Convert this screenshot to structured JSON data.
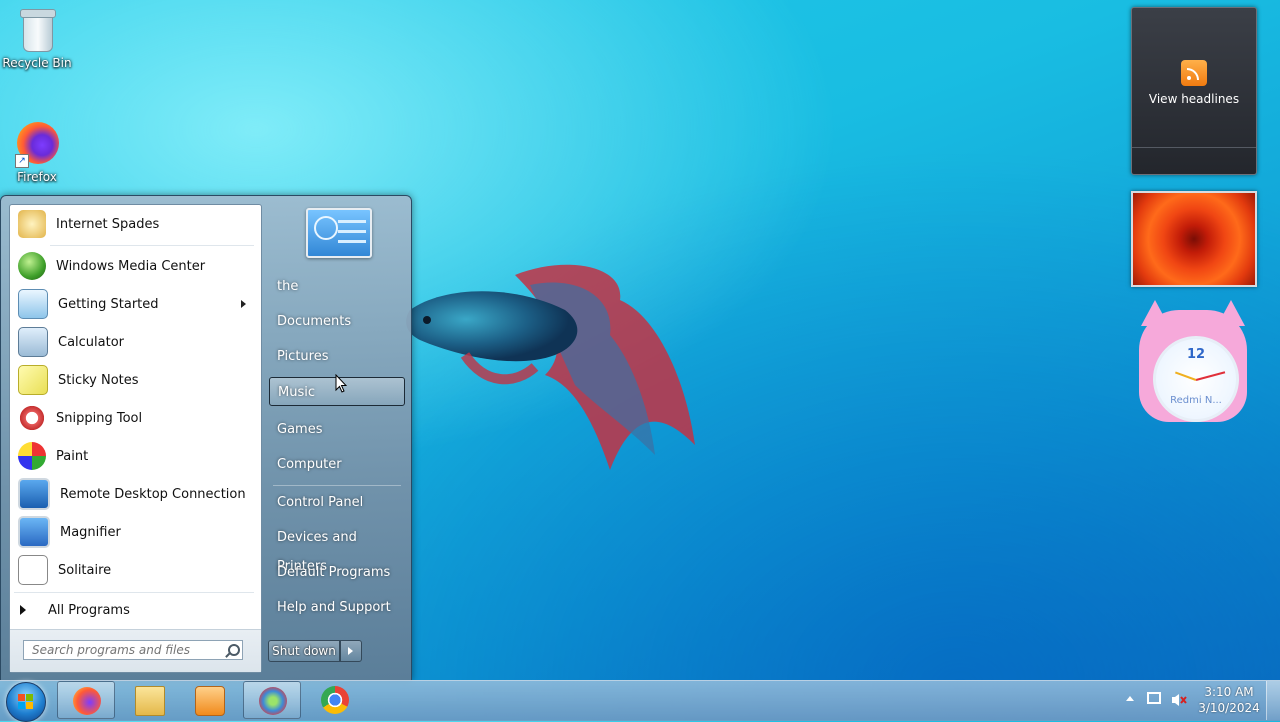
{
  "desktop": {
    "icons": [
      {
        "label": "Recycle Bin"
      },
      {
        "label": "Firefox"
      }
    ]
  },
  "gadgets": {
    "feed_label": "View headlines",
    "clock_label": "Redmi N...",
    "clock_number": "12"
  },
  "start_menu": {
    "programs": [
      {
        "label": "Internet Spades"
      },
      {
        "label": "Windows Media Center"
      },
      {
        "label": "Getting Started"
      },
      {
        "label": "Calculator"
      },
      {
        "label": "Sticky Notes"
      },
      {
        "label": "Snipping Tool"
      },
      {
        "label": "Paint"
      },
      {
        "label": "Remote Desktop Connection"
      },
      {
        "label": "Magnifier"
      },
      {
        "label": "Solitaire"
      }
    ],
    "all_programs": "All Programs",
    "search_placeholder": "Search programs and files",
    "right_items": [
      {
        "label": "the"
      },
      {
        "label": "Documents"
      },
      {
        "label": "Pictures"
      },
      {
        "label": "Music"
      },
      {
        "label": "Games"
      },
      {
        "label": "Computer"
      },
      {
        "label": "Control Panel"
      },
      {
        "label": "Devices and Printers"
      },
      {
        "label": "Default Programs"
      },
      {
        "label": "Help and Support"
      }
    ],
    "shutdown_label": "Shut down"
  },
  "taskbar": {
    "time": "3:10 AM",
    "date": "3/10/2024",
    "pinned": [
      "firefox-icon",
      "file-explorer-icon",
      "media-player-icon",
      "network-icon",
      "chrome-icon"
    ]
  },
  "colors": {
    "accent": "#1e86d6",
    "desktop_top": "#22c9e8",
    "desktop_bottom": "#0b73c2"
  }
}
